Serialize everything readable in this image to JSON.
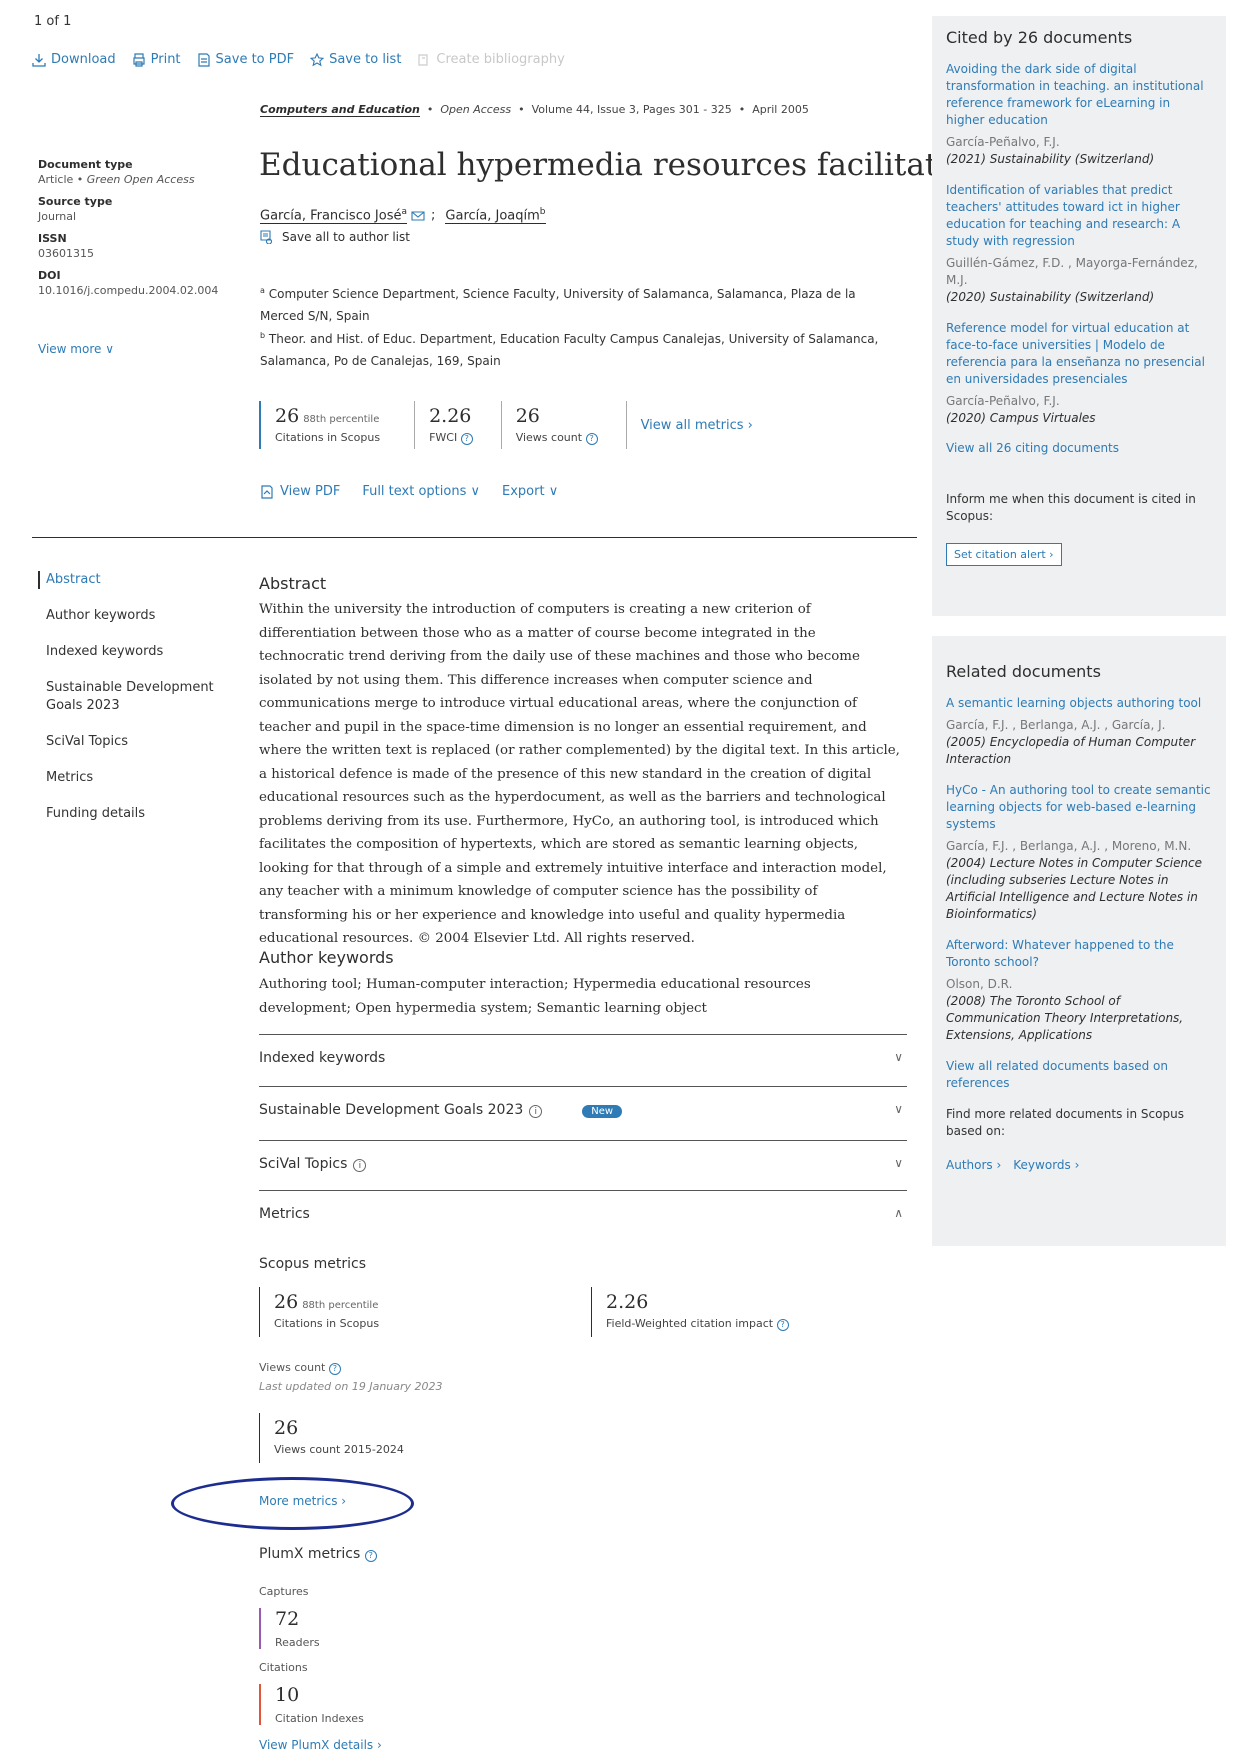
{
  "pager": "1 of 1",
  "actions": {
    "download": "Download",
    "print": "Print",
    "save_pdf": "Save to PDF",
    "save_list": "Save to list",
    "create_bib": "Create bibliography"
  },
  "source": {
    "journal": "Computers and Education",
    "access": "Open Access",
    "details": "Volume 44, Issue 3, Pages 301 - 325",
    "date": "April 2005"
  },
  "title": "Educational hypermedia resources facilitator",
  "authors": [
    {
      "name": "García, Francisco José",
      "sup": "a"
    },
    {
      "name": "García, Joaqím",
      "sup": "b"
    }
  ],
  "save_author": "Save all to author list",
  "affiliations": [
    {
      "sup": "a",
      "text": "Computer Science Department, Science Faculty, University of Salamanca, Salamanca, Plaza de la Merced S/N, Spain"
    },
    {
      "sup": "b",
      "text": "Theor. and Hist. of Educ. Department, Education Faculty Campus Canalejas, University of Salamanca, Salamanca, Po de Canalejas, 169, Spain"
    }
  ],
  "docinfo": {
    "type_label": "Document type",
    "type_value": "Article",
    "type_access": "Green Open Access",
    "source_label": "Source type",
    "source_value": "Journal",
    "issn_label": "ISSN",
    "issn_value": "03601315",
    "doi_label": "DOI",
    "doi_value": "10.1016/j.compedu.2004.02.004",
    "view_more": "View more"
  },
  "metrics": {
    "citations": "26",
    "percentile": "88th percentile",
    "citations_label": "Citations in Scopus",
    "fwci": "2.26",
    "fwci_label": "FWCI",
    "views": "26",
    "views_label": "Views count",
    "view_all": "View all metrics"
  },
  "pdf_row": {
    "view_pdf": "View PDF",
    "full_text": "Full text options",
    "export": "Export"
  },
  "sidenav": [
    "Abstract",
    "Author keywords",
    "Indexed keywords",
    "Sustainable Development Goals 2023",
    "SciVal Topics",
    "Metrics",
    "Funding details"
  ],
  "abstract": {
    "heading": "Abstract",
    "text": "Within the university the introduction of computers is creating a new criterion of differentiation between those who as a matter of course become integrated in the technocratic trend deriving from the daily use of these machines and those who become isolated by not using them. This difference increases when computer science and communications merge to introduce virtual educational areas, where the conjunction of teacher and pupil in the space-time dimension is no longer an essential requirement, and where the written text is replaced (or rather complemented) by the digital text. In this article, a historical defence is made of the presence of this new standard in the creation of digital educational resources such as the hyperdocument, as well as the barriers and technological problems deriving from its use. Furthermore, HyCo, an authoring tool, is introduced which facilitates the composition of hypertexts, which are stored as semantic learning objects, looking for that through of a simple and extremely intuitive interface and interaction model, any teacher with a minimum knowledge of computer science has the possibility of transforming his or her experience and knowledge into useful and quality hypermedia educational resources. © 2004 Elsevier Ltd. All rights reserved."
  },
  "keywords": {
    "heading": "Author keywords",
    "text": "Authoring tool;   Human-computer interaction;   Hypermedia educational resources development;   Open hypermedia system;   Semantic learning object"
  },
  "accordion": {
    "indexed": "Indexed keywords",
    "sdg": "Sustainable Development Goals 2023",
    "new_badge": "New",
    "scival": "SciVal Topics",
    "metrics": "Metrics"
  },
  "scopus_metrics": {
    "heading": "Scopus metrics",
    "citations": "26",
    "percentile": "88th percentile",
    "citations_label": "Citations in Scopus",
    "fwci": "2.26",
    "fwci_label": "Field-Weighted citation impact",
    "views_heading": "Views count",
    "updated": "Last updated on 19 January 2023",
    "views": "26",
    "views_label": "Views count 2015-2024",
    "more": "More metrics"
  },
  "plumx": {
    "heading": "PlumX metrics",
    "captures": "Captures",
    "readers_value": "72",
    "readers_label": "Readers",
    "citations": "Citations",
    "ci_value": "10",
    "ci_label": "Citation Indexes",
    "details": "View PlumX details"
  },
  "cited_by": {
    "heading": "Cited by 26 documents",
    "items": [
      {
        "title": "Avoiding the dark side of digital transformation in teaching. an institutional reference framework for eLearning in higher education",
        "authors": "García-Peñalvo, F.J.",
        "source": "(2021) Sustainability (Switzerland)"
      },
      {
        "title": "Identification of variables that predict teachers' attitudes toward ict in higher education for teaching and research: A study with regression",
        "authors": "Guillén-Gámez, F.D. , Mayorga-Fernández, M.J.",
        "source": "(2020) Sustainability (Switzerland)"
      },
      {
        "title": "Reference model for virtual education at face-to-face universities | Modelo de referencia para la enseñanza no presencial en universidades presenciales",
        "authors": "García-Peñalvo, F.J.",
        "source": "(2020) Campus Virtuales"
      }
    ],
    "view_all": "View all 26 citing documents",
    "inform": "Inform me when this document is cited in Scopus:",
    "alert": "Set citation alert"
  },
  "related": {
    "heading": "Related documents",
    "items": [
      {
        "title": "A semantic learning objects authoring tool",
        "authors": "García, F.J. , Berlanga, A.J. , García, J.",
        "source": "(2005) Encyclopedia of Human Computer Interaction"
      },
      {
        "title": "HyCo - An authoring tool to create semantic learning objects for web-based e-learning systems",
        "authors": "García, F.J. , Berlanga, A.J. , Moreno, M.N.",
        "source": "(2004) Lecture Notes in Computer Science (including subseries Lecture Notes in Artificial Intelligence and Lecture Notes in Bioinformatics)"
      },
      {
        "title": "Afterword: Whatever happened to the Toronto school?",
        "authors": "Olson, D.R.",
        "source": "(2008) The Toronto School of Communication Theory Interpretations, Extensions, Applications"
      }
    ],
    "view_all": "View all related documents based on references",
    "find_more": "Find more related documents in Scopus based on:",
    "authors_link": "Authors",
    "keywords_link": "Keywords"
  }
}
